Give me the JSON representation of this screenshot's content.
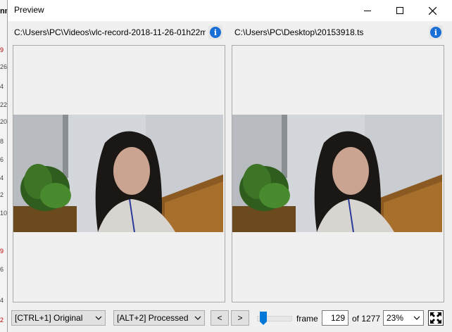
{
  "window": {
    "title": "Preview"
  },
  "left_panel": {
    "path": "C:\\Users\\PC\\Videos\\vlc-record-2018-11-26-01h22m",
    "info_glyph": "i"
  },
  "right_panel": {
    "path": "C:\\Users\\PC\\Desktop\\20153918.ts",
    "info_glyph": "i"
  },
  "controls": {
    "original_select": "[CTRL+1] Original",
    "processed_select": "[ALT+2] Processed",
    "prev_label": "<",
    "next_label": ">",
    "frame_label": "frame",
    "frame_value": "129",
    "of_label": "of 1277",
    "zoom_value": "23%",
    "slider_position_fraction": 0.1
  },
  "background_app": {
    "top_text": "nn",
    "ticks": [
      "9",
      "26",
      "4",
      "22",
      "20",
      "8",
      "6",
      "4",
      "2",
      "10",
      "9",
      "6",
      "4",
      "2"
    ]
  }
}
